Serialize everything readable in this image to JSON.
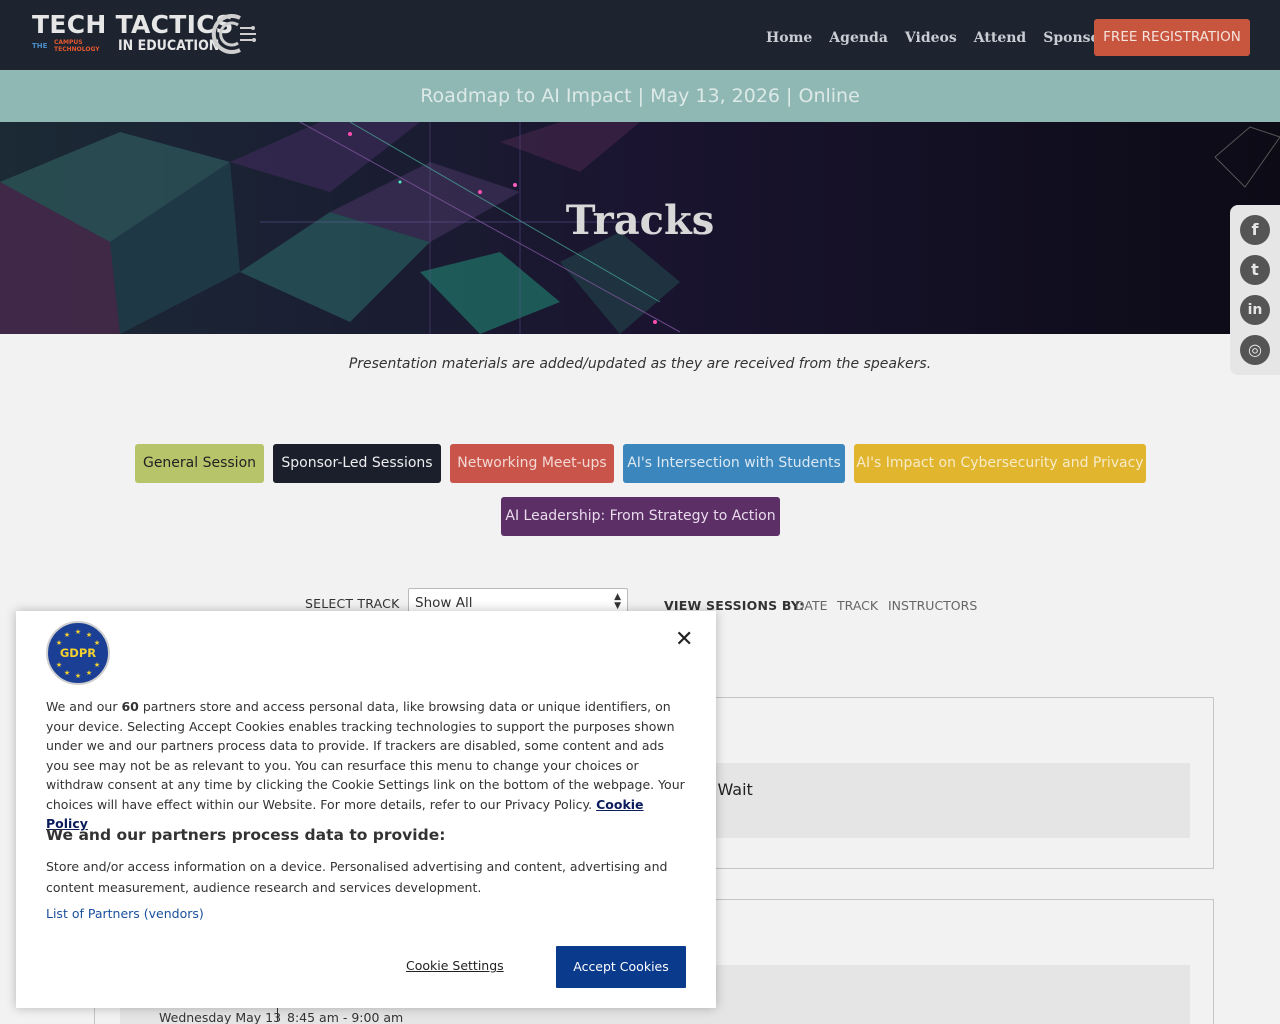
{
  "header": {
    "logo_main": "TECH TACTICS",
    "logo_the": "THE",
    "logo_ct": "CAMPUS TECHNOLOGY",
    "logo_sub": "IN EDUCATION",
    "nav": [
      "Home",
      "Agenda",
      "Videos",
      "Attend",
      "Sponsor"
    ],
    "register_label": "FREE REGISTRATION"
  },
  "subheader": {
    "text": "Roadmap to AI Impact | May 13, 2026 | Online"
  },
  "hero": {
    "title": "Tracks"
  },
  "social": {
    "icons": [
      "facebook-icon",
      "twitter-icon",
      "linkedin-icon",
      "instagram-icon"
    ],
    "glyphs": [
      "f",
      "t",
      "in",
      "◎"
    ]
  },
  "intro": {
    "text": "Presentation materials are added/updated as they are received from the speakers."
  },
  "tracks": [
    {
      "label": "General Session",
      "color": "#b8c46a"
    },
    {
      "label": "Sponsor-Led Sessions",
      "color": "#1b1f2b"
    },
    {
      "label": "Networking Meet-ups",
      "color": "#c9544a"
    },
    {
      "label": "AI's Intersection with Students",
      "color": "#3a86bd"
    },
    {
      "label": "AI's Impact on Cybersecurity and Privacy",
      "color": "#e2b52f"
    },
    {
      "label": "AI Leadership: From Strategy to Action",
      "color": "#5c2f66"
    }
  ],
  "filters": {
    "select_label": "SELECT TRACK",
    "select_value": "Show All",
    "view_label": "VIEW SESSIONS BY:",
    "view_options": [
      "DATE",
      "TRACK",
      "INSTRUCTORS"
    ]
  },
  "sessions": {
    "first_title_fragment": ": Wait",
    "second_date": "Wednesday May 13",
    "second_time": "8:45 am - 9:00 am"
  },
  "cookie": {
    "body_pre": "We and our ",
    "body_count": "60",
    "body_post": " partners store and access personal data, like browsing data or unique identifiers, on your device. Selecting Accept Cookies enables tracking technologies to support the purposes shown under we and our partners process data to provide. If trackers are disabled, some content and ads you see may not be as relevant to you. You can resurface this menu to change your choices or withdraw consent at any time by clicking the Cookie Settings link on the bottom of the webpage. Your choices will have effect within our Website. For more details, refer to our Privacy Policy.",
    "cookie_policy_link": "Cookie Policy",
    "heading": "We and our partners process data to provide:",
    "purposes": "Store and/or access information on a device. Personalised advertising and content, advertising and content measurement, audience research and services development.",
    "partners_link": "List of Partners (vendors)",
    "settings_label": "Cookie Settings",
    "accept_label": "Accept Cookies",
    "badge_text": "GDPR",
    "close_glyph": "✕"
  }
}
